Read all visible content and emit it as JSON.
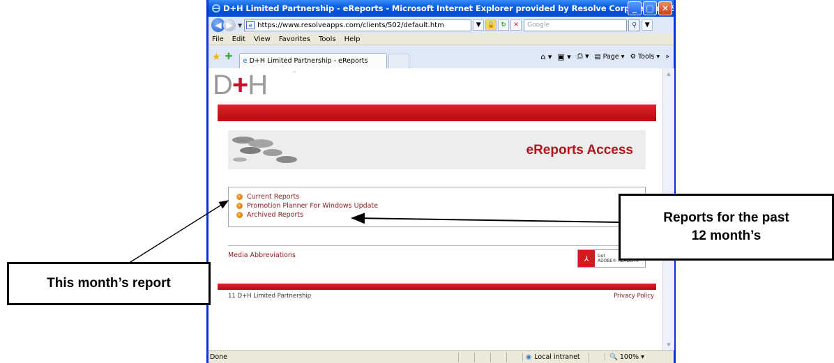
{
  "window": {
    "title": "D+H Limited Partnership - eReports - Microsoft Internet Explorer provided by Resolve Corporation - Saint John",
    "controls": {
      "minimize": "_",
      "maximize": "□",
      "close": "✕"
    }
  },
  "address": {
    "url": "https://www.resolveapps.com/clients/502/default.htm",
    "search_placeholder": "Google"
  },
  "menu": [
    "File",
    "Edit",
    "View",
    "Favorites",
    "Tools",
    "Help"
  ],
  "tab": {
    "label": "D+H Limited Partnership - eReports"
  },
  "commandbar": {
    "page": "Page",
    "tools": "Tools",
    "more": "»"
  },
  "page": {
    "logo_left": "D",
    "logo_plus": "+",
    "logo_right": "H",
    "logo_tm": "™",
    "banner_title": "eReports Access",
    "links": [
      "Current Reports",
      "Promotion Planner For Windows Update",
      "Archived Reports"
    ],
    "media_link": "Media Abbreviations",
    "adobe_get": "Get",
    "adobe_reader": "ADOBE® READER®",
    "copyright": "11 D+H Limited Partnership",
    "privacy": "Privacy Policy"
  },
  "status": {
    "text": "Done",
    "zone": "Local intranet",
    "zoom": "100%"
  },
  "callouts": {
    "left": "This month’s report",
    "right_line1": "Reports for the past",
    "right_line2": "12 month’s"
  }
}
